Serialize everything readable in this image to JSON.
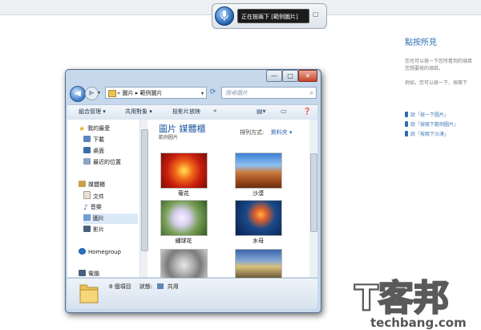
{
  "speech": {
    "status": "正在按兩下 [範例圖片]"
  },
  "help": {
    "title": "點按所見",
    "para1_line1": "您也可以按一下您所看到的項目",
    "para1_line2": "您想要按的項目。",
    "para2": "例如，您可以按一下、按兩下",
    "links": [
      "說「按一下圖片」",
      "說「按兩下範例圖片」",
      "說「按兩下沙漠」"
    ]
  },
  "window": {
    "controls": [
      "—",
      "□",
      "✕"
    ],
    "address": [
      "«",
      "圖片",
      "▸",
      "範例圖片"
    ],
    "address_full": "« 圖片 ▸ 範例圖片",
    "search_placeholder": "搜尋圖片",
    "toolbar": {
      "organize": "組合管理 ▾",
      "share": "共用對象 ▾",
      "slideshow": "投影片放映",
      "more": "»"
    },
    "nav_pane": {
      "favorites": "我的最愛",
      "downloads": "下載",
      "desktop": "桌面",
      "recent": "最近的位置",
      "libraries": "媒體櫃",
      "documents": "文件",
      "music": "音樂",
      "pictures": "圖片",
      "videos": "影片",
      "homegroup": "Homegroup",
      "computer": "電腦"
    },
    "library_title": "圖片 媒體櫃",
    "library_subtitle": "範例圖片",
    "arrange_label": "排列方式:",
    "arrange_value": "資料夾 ▾",
    "items": [
      {
        "label": "菊花"
      },
      {
        "label": "沙漠"
      },
      {
        "label": "繡球花"
      },
      {
        "label": "水母"
      },
      {
        "label": ""
      },
      {
        "label": ""
      }
    ],
    "status": {
      "count": "8 個項目",
      "state_label": "狀態:",
      "state_value": "共用"
    }
  },
  "watermark": {
    "brand": "T客邦",
    "domain": "techbang.com"
  },
  "colors": {
    "accent": "#2b6fb0",
    "window_frame": "#c6d8ec",
    "link": "#4377b3"
  }
}
